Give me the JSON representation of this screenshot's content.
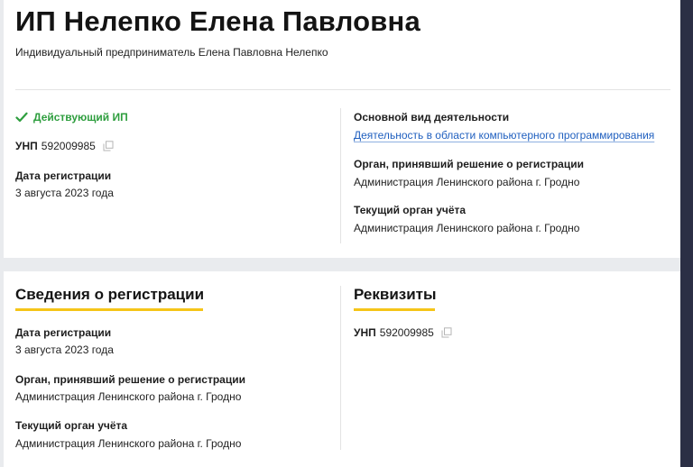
{
  "header": {
    "title": "ИП Нелепко Елена Павловна",
    "subtitle": "Индивидуальный предприниматель Елена Павловна Нелепко"
  },
  "status": {
    "label": "Действующий ИП",
    "color": "#2e9e3e",
    "icon": "checkmark-icon"
  },
  "summary": {
    "unp_label": "УНП",
    "unp_value": "592009985",
    "reg_date_label": "Дата регистрации",
    "reg_date_value": "3 августа 2023 года",
    "activity_label": "Основной вид деятельности",
    "activity_value": "Деятельность в области компьютерного программирования",
    "authority_label": "Орган, принявший решение о регистрации",
    "authority_value": "Администрация Ленинского района г. Гродно",
    "tax_label": "Текущий орган учёта",
    "tax_value": "Администрация Ленинского района г. Гродно"
  },
  "registration": {
    "title": "Сведения о регистрации",
    "reg_date_label": "Дата регистрации",
    "reg_date_value": "3 августа 2023 года",
    "authority_label": "Орган, принявший решение о регистрации",
    "authority_value": "Администрация Ленинского района г. Гродно",
    "tax_label": "Текущий орган учёта",
    "tax_value": "Администрация Ленинского района г. Гродно"
  },
  "requisites": {
    "title": "Реквизиты",
    "unp_label": "УНП",
    "unp_value": "592009985"
  },
  "colors": {
    "accent_underline": "#f5c518",
    "link": "#1f5fbf",
    "status": "#2e9e3e"
  }
}
